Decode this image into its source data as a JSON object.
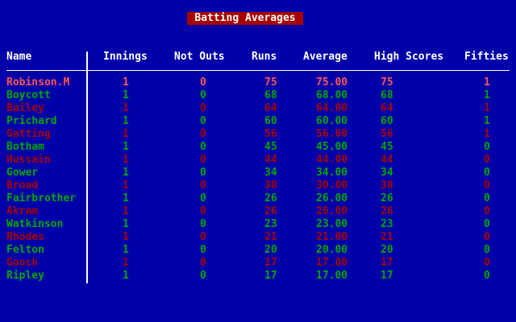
{
  "title": "Batting Averages",
  "columns": {
    "name": "Name",
    "innings": "Innings",
    "not_outs": "Not Outs",
    "runs": "Runs",
    "average": "Average",
    "high_scores": "High Scores",
    "fifties": "Fifties"
  },
  "colors": {
    "background": "#0000a8",
    "title_bg": "#a80000",
    "header": "#ffffff",
    "highlight": "#ff5555",
    "green": "#00a800",
    "red": "#a80000"
  },
  "rows": [
    {
      "name": "Robinson.M",
      "innings": "1",
      "not_outs": "0",
      "runs": "75",
      "average": "75.00",
      "high": "75",
      "fifties": "1",
      "color": "highlight"
    },
    {
      "name": "Boycott",
      "innings": "1",
      "not_outs": "0",
      "runs": "68",
      "average": "68.00",
      "high": "68",
      "fifties": "1",
      "color": "green"
    },
    {
      "name": "Bailey",
      "innings": "1",
      "not_outs": "0",
      "runs": "64",
      "average": "64.00",
      "high": "64",
      "fifties": "1",
      "color": "red"
    },
    {
      "name": "Prichard",
      "innings": "1",
      "not_outs": "0",
      "runs": "60",
      "average": "60.00",
      "high": "60",
      "fifties": "1",
      "color": "green"
    },
    {
      "name": "Gatting",
      "innings": "1",
      "not_outs": "0",
      "runs": "56",
      "average": "56.00",
      "high": "56",
      "fifties": "1",
      "color": "red"
    },
    {
      "name": "Botham",
      "innings": "1",
      "not_outs": "0",
      "runs": "45",
      "average": "45.00",
      "high": "45",
      "fifties": "0",
      "color": "green"
    },
    {
      "name": "Hussain",
      "innings": "1",
      "not_outs": "0",
      "runs": "44",
      "average": "44.00",
      "high": "44",
      "fifties": "0",
      "color": "red"
    },
    {
      "name": "Gower",
      "innings": "1",
      "not_outs": "0",
      "runs": "34",
      "average": "34.00",
      "high": "34",
      "fifties": "0",
      "color": "green"
    },
    {
      "name": "Broad",
      "innings": "1",
      "not_outs": "0",
      "runs": "30",
      "average": "30.00",
      "high": "30",
      "fifties": "0",
      "color": "red"
    },
    {
      "name": "Fairbrother",
      "innings": "1",
      "not_outs": "0",
      "runs": "26",
      "average": "26.00",
      "high": "26",
      "fifties": "0",
      "color": "green"
    },
    {
      "name": "Akram",
      "innings": "1",
      "not_outs": "0",
      "runs": "26",
      "average": "26.00",
      "high": "26",
      "fifties": "0",
      "color": "red"
    },
    {
      "name": "Watkinson",
      "innings": "1",
      "not_outs": "0",
      "runs": "23",
      "average": "23.00",
      "high": "23",
      "fifties": "0",
      "color": "green"
    },
    {
      "name": "Rhodes",
      "innings": "1",
      "not_outs": "0",
      "runs": "21",
      "average": "21.00",
      "high": "21",
      "fifties": "0",
      "color": "red"
    },
    {
      "name": "Felton",
      "innings": "1",
      "not_outs": "0",
      "runs": "20",
      "average": "20.00",
      "high": "20",
      "fifties": "0",
      "color": "green"
    },
    {
      "name": "Gooch",
      "innings": "1",
      "not_outs": "0",
      "runs": "17",
      "average": "17.00",
      "high": "17",
      "fifties": "0",
      "color": "red"
    },
    {
      "name": "Ripley",
      "innings": "1",
      "not_outs": "0",
      "runs": "17",
      "average": "17.00",
      "high": "17",
      "fifties": "0",
      "color": "green"
    }
  ]
}
